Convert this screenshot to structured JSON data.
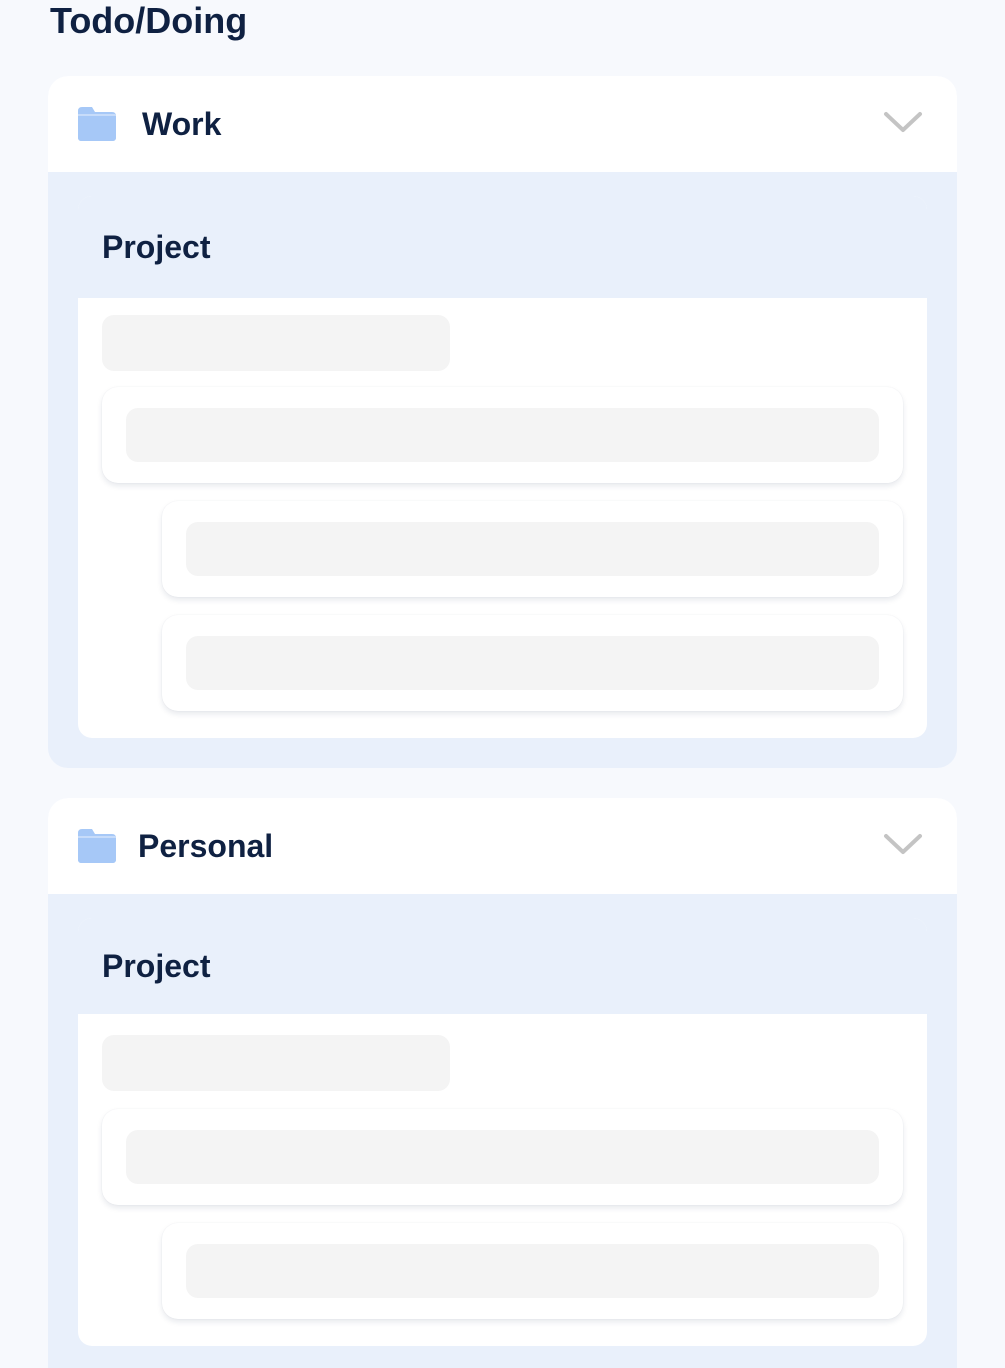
{
  "page": {
    "title": "Todo/Doing"
  },
  "colors": {
    "accent_folder": "#a6c8f7",
    "text": "#0f2142",
    "group_bg": "#e9f0fb",
    "skeleton": "#f4f4f4"
  },
  "groups": [
    {
      "name": "Work",
      "icon": "folder-icon",
      "toggle_icon": "chevron-down-icon",
      "project": {
        "title": "Project"
      }
    },
    {
      "name": "Personal",
      "icon": "folder-icon",
      "toggle_icon": "chevron-down-icon",
      "project": {
        "title": "Project"
      }
    }
  ]
}
